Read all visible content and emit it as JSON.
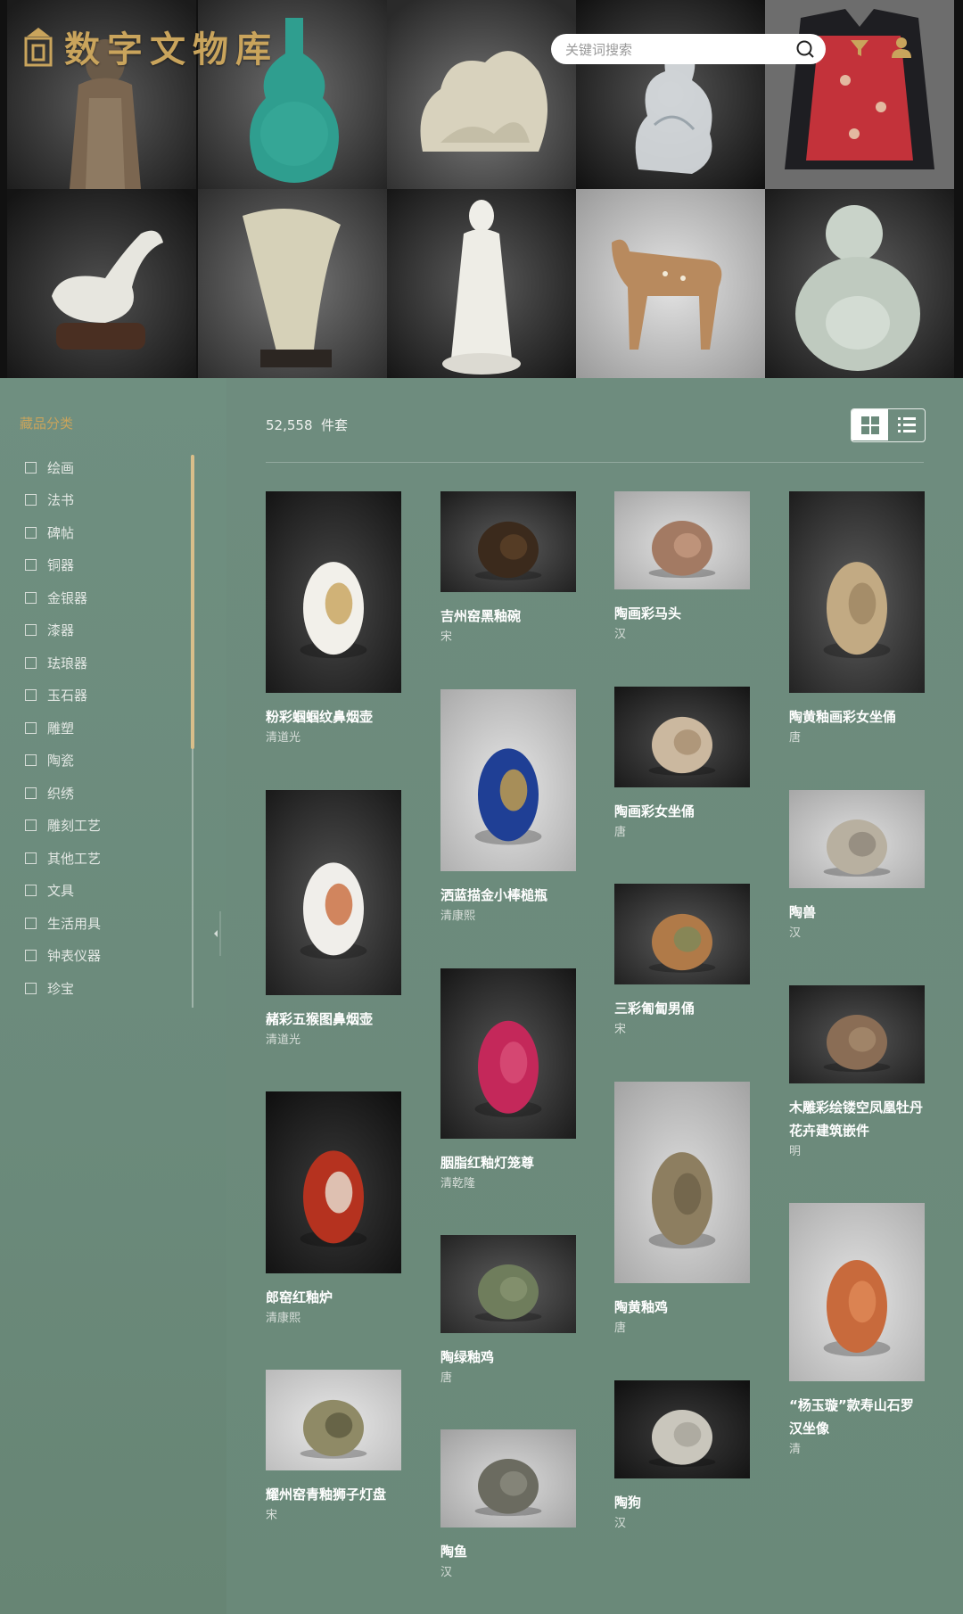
{
  "header": {
    "logo_text": "数字文物库",
    "search_placeholder": "关键词搜索",
    "accent": "#c9a45c"
  },
  "sidebar": {
    "title": "藏品分类",
    "categories": [
      "绘画",
      "法书",
      "碑帖",
      "铜器",
      "金银器",
      "漆器",
      "珐琅器",
      "玉石器",
      "雕塑",
      "陶瓷",
      "织绣",
      "雕刻工艺",
      "其他工艺",
      "文具",
      "生活用具",
      "钟表仪器",
      "珍宝"
    ]
  },
  "results": {
    "count": "52,558",
    "unit": "件套"
  },
  "items": [
    {
      "name": "粉彩蝈蝈纹鼻烟壶",
      "era": "清道光"
    },
    {
      "name": "赭彩五猴图鼻烟壶",
      "era": "清道光"
    },
    {
      "name": "郎窑红釉炉",
      "era": "清康熙"
    },
    {
      "name": "耀州窑青釉狮子灯盘",
      "era": "宋"
    },
    {
      "name": "吉州窑黑釉碗",
      "era": "宋"
    },
    {
      "name": "洒蓝描金小棒槌瓶",
      "era": "清康熙"
    },
    {
      "name": "胭脂红釉灯笼尊",
      "era": "清乾隆"
    },
    {
      "name": "陶绿釉鸡",
      "era": "唐"
    },
    {
      "name": "陶鱼",
      "era": "汉"
    },
    {
      "name": "陶画彩马头",
      "era": "汉"
    },
    {
      "name": "陶画彩女坐俑",
      "era": "唐"
    },
    {
      "name": "三彩匍匐男俑",
      "era": "宋"
    },
    {
      "name": "陶黄釉鸡",
      "era": "唐"
    },
    {
      "name": "陶狗",
      "era": "汉"
    },
    {
      "name": "陶黄釉画彩女坐俑",
      "era": "唐"
    },
    {
      "name": "陶兽",
      "era": "汉"
    },
    {
      "name": "木雕彩绘镂空凤凰牡丹花卉建筑嵌件",
      "era": "明"
    },
    {
      "name": "“杨玉璇”款寿山石罗汉坐像",
      "era": "清"
    }
  ]
}
